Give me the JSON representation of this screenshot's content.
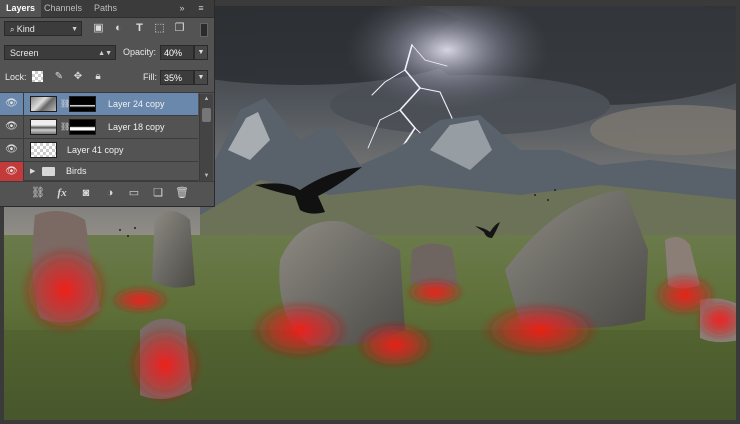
{
  "panel": {
    "tabs": [
      {
        "label": "Layers",
        "active": true
      },
      {
        "label": "Channels",
        "active": false
      },
      {
        "label": "Paths",
        "active": false
      }
    ],
    "collapse_glyph": "»",
    "menu_glyph": "≡",
    "filter": {
      "value": "Kind",
      "icons": [
        "image-filter-icon",
        "adjustment-filter-icon",
        "type-filter-icon",
        "shape-filter-icon",
        "smart-object-filter-icon"
      ]
    },
    "blend_mode": "Screen",
    "opacity": {
      "label": "Opacity:",
      "value": "40%"
    },
    "lock": {
      "label": "Lock:",
      "icons": [
        "lock-transparent-icon",
        "lock-paint-icon",
        "lock-move-icon",
        "lock-all-icon"
      ]
    },
    "fill": {
      "label": "Fill:",
      "value": "35%"
    },
    "layers": [
      {
        "name": "Layer 24 copy",
        "selected": true,
        "visible": true,
        "has_mask": true
      },
      {
        "name": "Layer 18 copy",
        "selected": false,
        "visible": true,
        "has_mask": true
      },
      {
        "name": "Layer 41 copy",
        "selected": false,
        "visible": true,
        "has_mask": false
      },
      {
        "name": "Birds",
        "selected": false,
        "visible": true,
        "group": true
      }
    ],
    "bottom_icons": [
      "link-layers-icon",
      "fx-icon",
      "add-mask-icon",
      "adjustment-layer-icon",
      "new-group-icon",
      "new-layer-icon",
      "trash-icon"
    ],
    "fx_label": "fx"
  },
  "canvas": {
    "scene": "stone circle with lightning storm",
    "colors": {
      "accent_selected": "#6a87ac",
      "eye_group": "#c33a3a",
      "glow": "#e0201c"
    }
  }
}
